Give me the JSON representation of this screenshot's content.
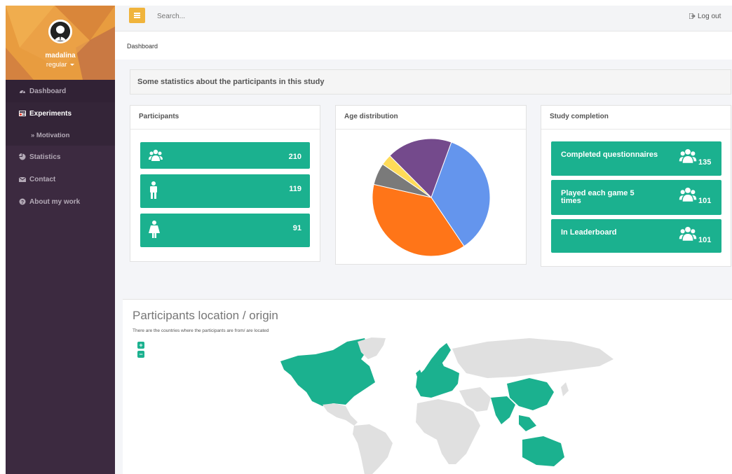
{
  "user": {
    "name": "madalina",
    "role": "regular"
  },
  "sidebar": {
    "items": [
      {
        "label": "Dashboard",
        "icon": "dashboard-icon"
      },
      {
        "label": "Experiments",
        "icon": "experiments-icon"
      },
      {
        "label": "» Motivation"
      },
      {
        "label": "Statistics",
        "icon": "pie-chart-icon"
      },
      {
        "label": "Contact",
        "icon": "envelope-icon"
      },
      {
        "label": "About my work",
        "icon": "question-circle-icon"
      }
    ]
  },
  "topbar": {
    "search_placeholder": "Search...",
    "logout": "Log out"
  },
  "breadcrumb": "Dashboard",
  "stats": {
    "header": "Some statistics about the participants in this study",
    "participants": {
      "title": "Participants",
      "rows": [
        {
          "icon": "users-icon",
          "value": "210"
        },
        {
          "icon": "male-icon",
          "value": "119"
        },
        {
          "icon": "female-icon",
          "value": "91"
        }
      ]
    },
    "age": {
      "title": "Age distribution",
      "chart_data": {
        "type": "pie",
        "values": [
          35,
          38,
          6,
          3,
          18
        ],
        "colors": [
          "#6495ed",
          "#ff7518",
          "#7a7a7a",
          "#ffdb58",
          "#744a8c"
        ]
      }
    },
    "completion": {
      "title": "Study completion",
      "rows": [
        {
          "label": "Completed questionnaires",
          "value": "135"
        },
        {
          "label": "Played each game 5 times",
          "value": "101"
        },
        {
          "label": "In Leaderboard",
          "value": "101"
        }
      ]
    }
  },
  "map": {
    "title": "Participants location / origin",
    "subtitle": "There are the countries where the participants are from/ are located",
    "zoom_in": "+",
    "zoom_out": "−"
  },
  "colors": {
    "accent": "#1bb18f",
    "sidebar": "#3c2a40",
    "menu_button": "#f0b43c"
  }
}
